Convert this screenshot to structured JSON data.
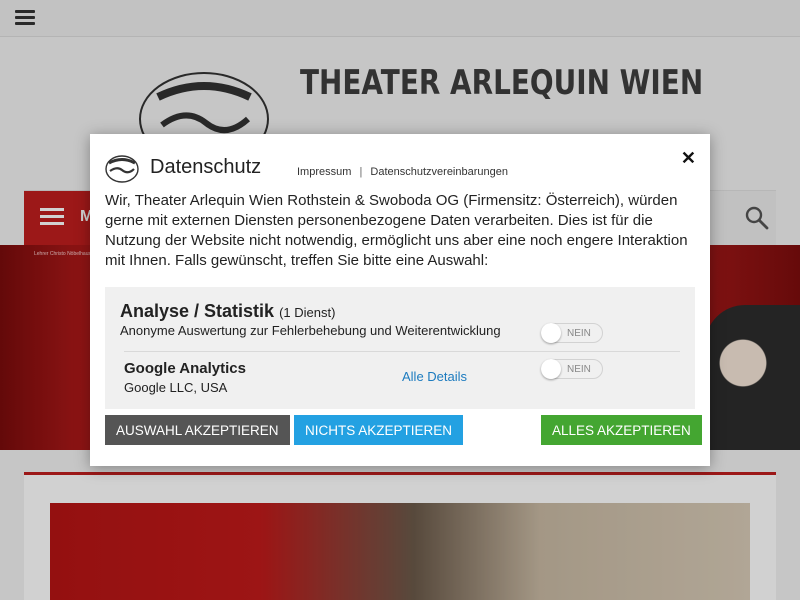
{
  "site": {
    "title": "THEATER ARLEQUIN WIEN",
    "menu_label": "M",
    "logo_alt": "Theater Arlequin Wien logo"
  },
  "hero": {
    "breadcrumb": "Lehrer Christo Nöbelhaus um..."
  },
  "dialog": {
    "title": "Datenschutz",
    "links": {
      "impressum": "Impressum",
      "separator": "|",
      "privacy": "Datenschutzvereinbarungen"
    },
    "close": "✕",
    "text": "Wir, Theater Arlequin Wien Rothstein & Swoboda OG (Firmensitz: Österreich), würden gerne mit externen Diensten personenbezogene Daten verarbeiten. Dies ist für die Nutzung der Website nicht notwendig, ermöglicht uns aber eine noch engere Interaktion mit Ihnen. Falls gewünscht, treffen Sie bitte eine Auswahl:",
    "category": {
      "title": "Analyse / Statistik",
      "count": "(1 Dienst)",
      "description": "Anonyme Auswertung zur Fehlerbehebung und Weiterentwicklung",
      "toggle_label": "NEIN",
      "toggle_on": false
    },
    "service": {
      "name": "Google Analytics",
      "company": "Google LLC, USA",
      "details_link": " Alle Details",
      "toggle_label": "NEIN",
      "toggle_on": false
    },
    "buttons": {
      "save": "AUSWAHL AKZEPTIEREN",
      "decline": "NICHTS AKZEPTIEREN",
      "accept": "ALLES AKZEPTIEREN"
    }
  },
  "colors": {
    "brand_red": "#bf1e1e",
    "save_button": "#555555",
    "decline_button": "#23a1e2",
    "accept_button": "#44a631",
    "link": "#1c7bbf"
  },
  "icons": [
    "hamburger-icon",
    "search-icon",
    "close-icon",
    "theater-logo",
    "info-icon"
  ]
}
